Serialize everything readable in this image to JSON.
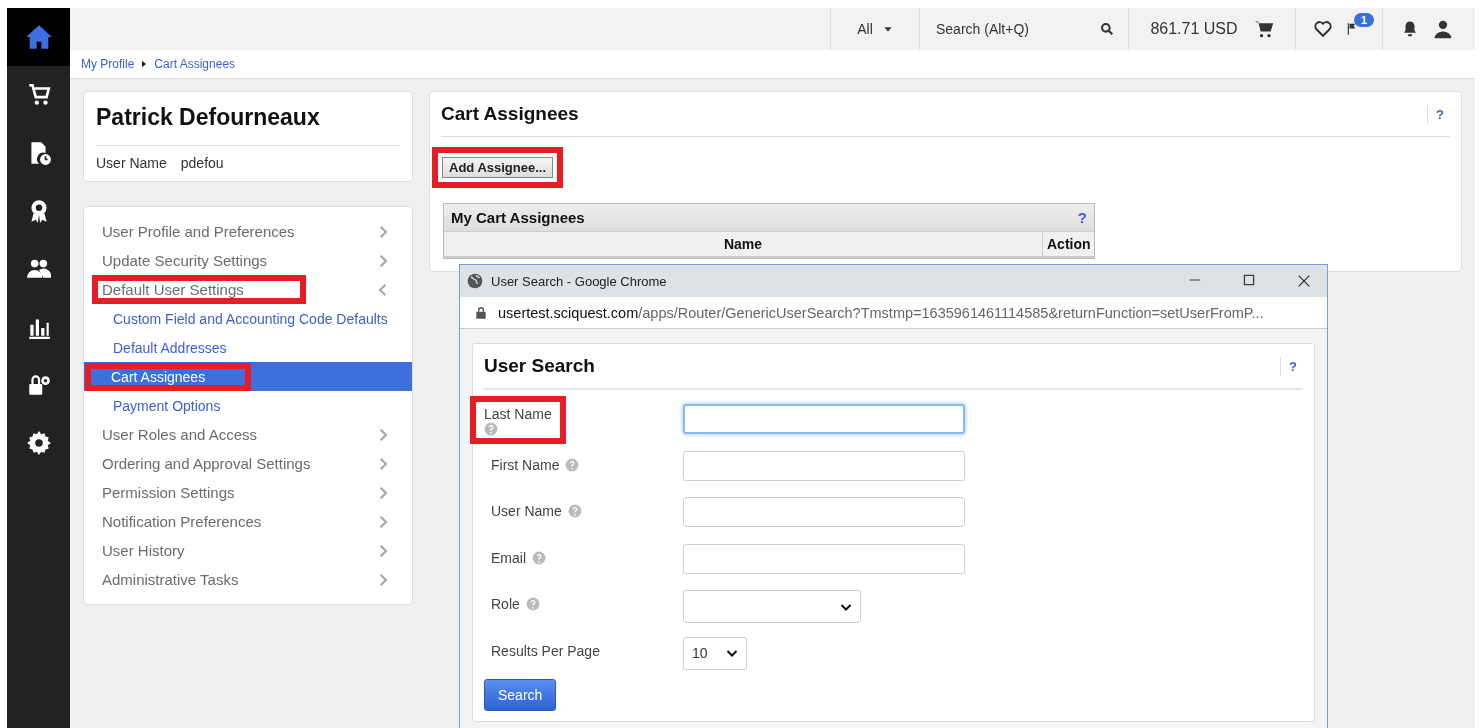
{
  "top_bar": {
    "scope": "All",
    "search": {
      "placeholder": "Search (Alt+Q)"
    },
    "cart_total": "861.71 USD",
    "flag_badge": "1"
  },
  "breadcrumb": [
    "My Profile",
    "Cart Assignees"
  ],
  "profile": {
    "name": "Patrick Defourneaux",
    "field_label": "User Name",
    "field_value": "pdefou"
  },
  "menu": [
    {
      "label": "User Profile and Preferences",
      "expanded": false,
      "annotated": false
    },
    {
      "label": "Update Security Settings",
      "expanded": false,
      "annotated": false
    },
    {
      "label": "Default User Settings",
      "expanded": true,
      "annotated": true,
      "children": [
        {
          "label": "Custom Field and Accounting Code Defaults",
          "selected": false,
          "annotated": false
        },
        {
          "label": "Default Addresses",
          "selected": false,
          "annotated": false
        },
        {
          "label": "Cart Assignees",
          "selected": true,
          "annotated": true
        },
        {
          "label": "Payment Options",
          "selected": false,
          "annotated": false
        }
      ]
    },
    {
      "label": "User Roles and Access",
      "expanded": false,
      "annotated": false
    },
    {
      "label": "Ordering and Approval Settings",
      "expanded": false,
      "annotated": false
    },
    {
      "label": "Permission Settings",
      "expanded": false,
      "annotated": false
    },
    {
      "label": "Notification Preferences",
      "expanded": false,
      "annotated": false
    },
    {
      "label": "User History",
      "expanded": false,
      "annotated": false
    },
    {
      "label": "Administrative Tasks",
      "expanded": false,
      "annotated": false
    }
  ],
  "main": {
    "title": "Cart Assignees",
    "help": "?",
    "add_button": {
      "label": "Add Assignee...",
      "annotated": true
    },
    "table": {
      "title": "My Cart Assignees",
      "help": "?",
      "columns": [
        "Name",
        "Action"
      ]
    }
  },
  "popup": {
    "window_title": "User Search - Google Chrome",
    "url_host": "usertest.sciquest.com",
    "url_rest": "/apps/Router/GenericUserSearch?Tmstmp=1635961461114585&returnFunction=setUserFromP...",
    "title": "User Search",
    "help": "?",
    "fields": [
      {
        "kind": "text",
        "label": "Last Name",
        "help_icon": true,
        "focused": true,
        "annotated": true
      },
      {
        "kind": "text",
        "label": "First Name",
        "help_icon": true,
        "focused": false,
        "annotated": false
      },
      {
        "kind": "text",
        "label": "User Name",
        "help_icon": true,
        "focused": false,
        "annotated": false
      },
      {
        "kind": "text",
        "label": "Email",
        "help_icon": true,
        "focused": false,
        "annotated": false
      },
      {
        "kind": "select",
        "label": "Role",
        "help_icon": true,
        "annotated": false
      },
      {
        "kind": "small_select",
        "label": "Results Per Page",
        "help_icon": false,
        "value": "10",
        "annotated": false
      }
    ],
    "search_button": "Search"
  }
}
